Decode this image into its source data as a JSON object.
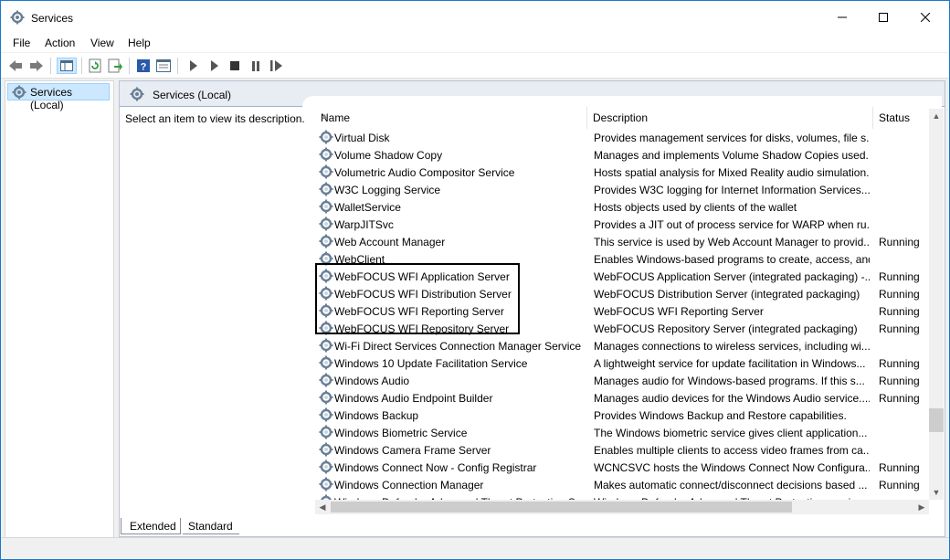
{
  "window": {
    "title": "Services"
  },
  "menu": [
    "File",
    "Action",
    "View",
    "Help"
  ],
  "tree": {
    "root_label": "Services (Local)"
  },
  "pane": {
    "header_label": "Services (Local)",
    "description_hint": "Select an item to view its description."
  },
  "columns": {
    "name": "Name",
    "description": "Description",
    "status": "Status"
  },
  "rows": [
    {
      "name": "Virtual Disk",
      "description": "Provides management services for disks, volumes, file s...",
      "status": ""
    },
    {
      "name": "Volume Shadow Copy",
      "description": "Manages and implements Volume Shadow Copies used...",
      "status": ""
    },
    {
      "name": "Volumetric Audio Compositor Service",
      "description": "Hosts spatial analysis for Mixed Reality audio simulation.",
      "status": ""
    },
    {
      "name": "W3C Logging Service",
      "description": "Provides W3C logging for Internet Information Services...",
      "status": ""
    },
    {
      "name": "WalletService",
      "description": "Hosts objects used by clients of the wallet",
      "status": ""
    },
    {
      "name": "WarpJITSvc",
      "description": "Provides a JIT out of process service for WARP when ru...",
      "status": ""
    },
    {
      "name": "Web Account Manager",
      "description": "This service is used by Web Account Manager to provid...",
      "status": "Running"
    },
    {
      "name": "WebClient",
      "description": "Enables Windows-based programs to create, access, and...",
      "status": ""
    },
    {
      "name": "WebFOCUS WFI Application Server",
      "description": "WebFOCUS Application Server (integrated packaging) -...",
      "status": "Running"
    },
    {
      "name": "WebFOCUS WFI Distribution Server",
      "description": "WebFOCUS Distribution Server (integrated packaging)",
      "status": "Running"
    },
    {
      "name": "WebFOCUS WFI Reporting Server",
      "description": "WebFOCUS WFI Reporting Server",
      "status": "Running"
    },
    {
      "name": "WebFOCUS WFI Repository Server",
      "description": "WebFOCUS Repository Server (integrated packaging)",
      "status": "Running"
    },
    {
      "name": "Wi-Fi Direct Services Connection Manager Service",
      "description": "Manages connections to wireless services, including wi...",
      "status": ""
    },
    {
      "name": "Windows 10 Update Facilitation Service",
      "description": "A lightweight service for update facilitation in Windows...",
      "status": "Running"
    },
    {
      "name": "Windows Audio",
      "description": "Manages audio for Windows-based programs.  If this s...",
      "status": "Running"
    },
    {
      "name": "Windows Audio Endpoint Builder",
      "description": "Manages audio devices for the Windows Audio service....",
      "status": "Running"
    },
    {
      "name": "Windows Backup",
      "description": "Provides Windows Backup and Restore capabilities.",
      "status": ""
    },
    {
      "name": "Windows Biometric Service",
      "description": "The Windows biometric service gives client application...",
      "status": ""
    },
    {
      "name": "Windows Camera Frame Server",
      "description": "Enables multiple clients to access video frames from ca...",
      "status": ""
    },
    {
      "name": "Windows Connect Now - Config Registrar",
      "description": "WCNCSVC hosts the Windows Connect Now Configura...",
      "status": "Running"
    },
    {
      "name": "Windows Connection Manager",
      "description": "Makes automatic connect/disconnect decisions based ...",
      "status": "Running"
    },
    {
      "name": "Windows Defender Advanced Threat Protection Se...",
      "description": "Windows Defender Advanced Threat Protection service...",
      "status": ""
    }
  ],
  "tabs": [
    "Extended",
    "Standard"
  ]
}
